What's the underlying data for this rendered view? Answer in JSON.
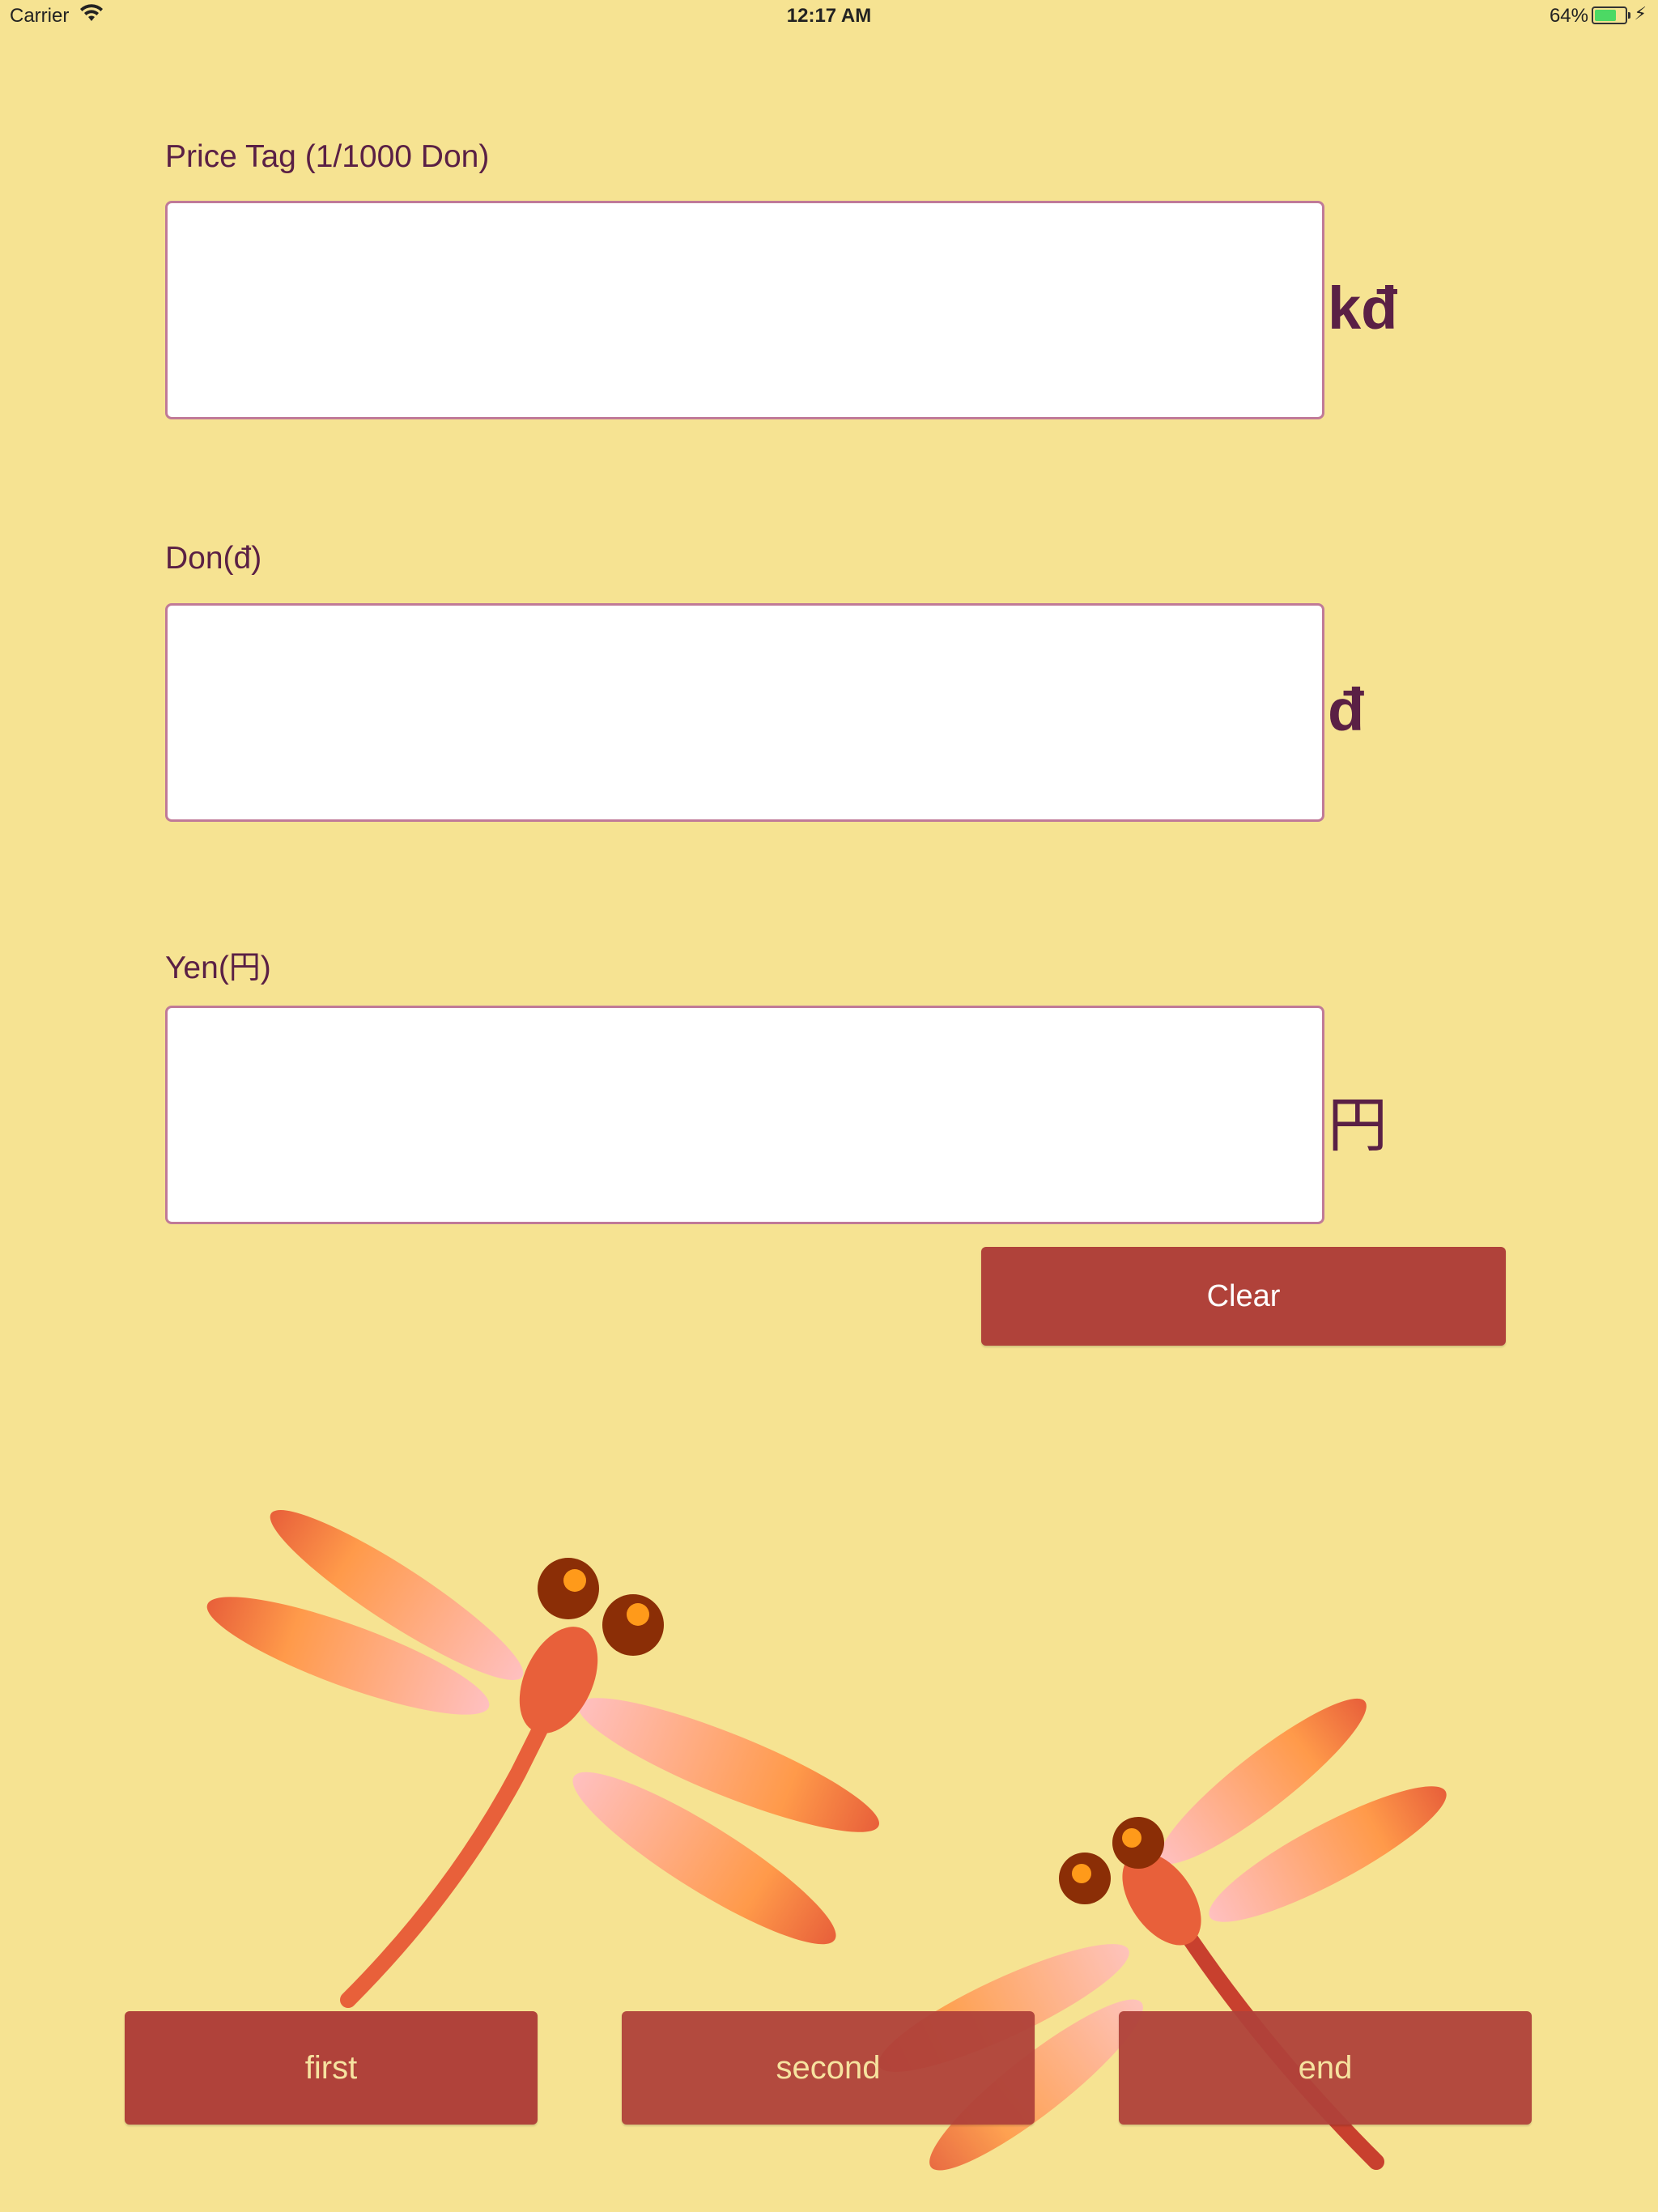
{
  "status_bar": {
    "carrier": "Carrier",
    "time": "12:17 AM",
    "battery_percent": "64%",
    "battery_level": 0.64
  },
  "fields": [
    {
      "label": "Price Tag (1/1000 Don)",
      "value": "",
      "unit": "kđ"
    },
    {
      "label": "Don(đ)",
      "value": "",
      "unit": "đ"
    },
    {
      "label": "Yen(円)",
      "value": "",
      "unit": "円"
    }
  ],
  "clear_button": {
    "label": "Clear"
  },
  "bottom_buttons": [
    {
      "label": "first"
    },
    {
      "label": "second"
    },
    {
      "label": "end"
    }
  ],
  "colors": {
    "background": "#f6e392",
    "button": "#b0423a",
    "text": "#5a2045",
    "field_border": "#c07a98"
  }
}
